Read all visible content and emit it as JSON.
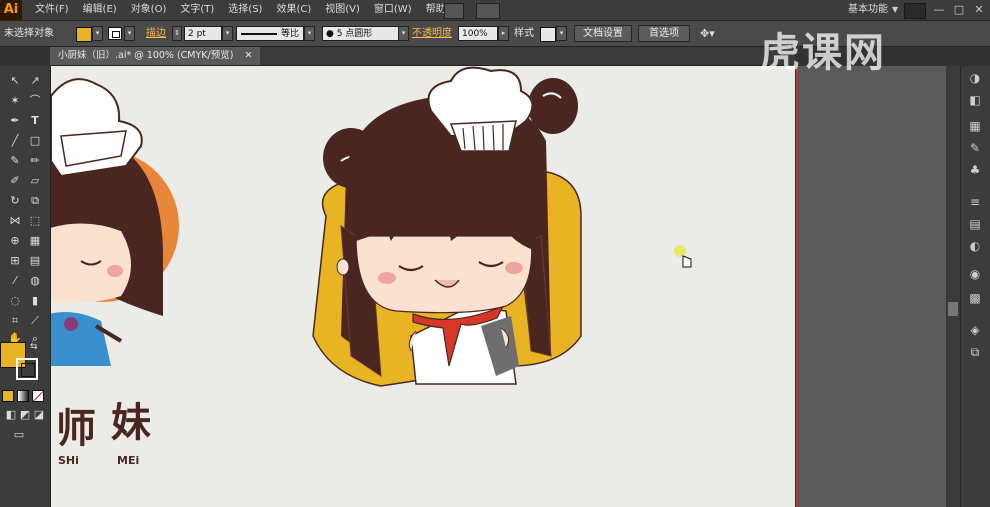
{
  "menubar": {
    "app_logo": "Ai",
    "menus": [
      "文件(F)",
      "编辑(E)",
      "对象(O)",
      "文字(T)",
      "选择(S)",
      "效果(C)",
      "视图(V)",
      "窗口(W)",
      "帮助(H)"
    ],
    "workspace": "基本功能",
    "workspace_arrow": "▼",
    "window_buttons": [
      "—",
      "□",
      "✕"
    ]
  },
  "controlbar": {
    "selection_status": "未选择对象",
    "stroke_label": "描边",
    "stroke_weight": "2 pt",
    "stroke_profile": "等比",
    "brush": "5 点圆形",
    "opacity_label": "不透明度",
    "opacity_value": "100%",
    "style_label": "样式",
    "doc_setup_button": "文档设置",
    "preferences_button": "首选项"
  },
  "tab": {
    "title": "小厨妹（旧）.ai* @ 100% (CMYK/预览)",
    "close": "✕"
  },
  "artwork": {
    "logo_chars": [
      "师",
      "妹"
    ],
    "logo_pinyin": [
      "SHi",
      "MEi"
    ]
  },
  "watermark": "虎课网",
  "colors": {
    "fill": "#e8b424",
    "stroke": "#ffffff",
    "hair": "#4a2620",
    "skin": "#fbe1cf",
    "background_shape": "#e8b424",
    "orange_circle": "#e8863a",
    "scarf": "#d9362a",
    "artboard_edge": "#b8362f"
  }
}
